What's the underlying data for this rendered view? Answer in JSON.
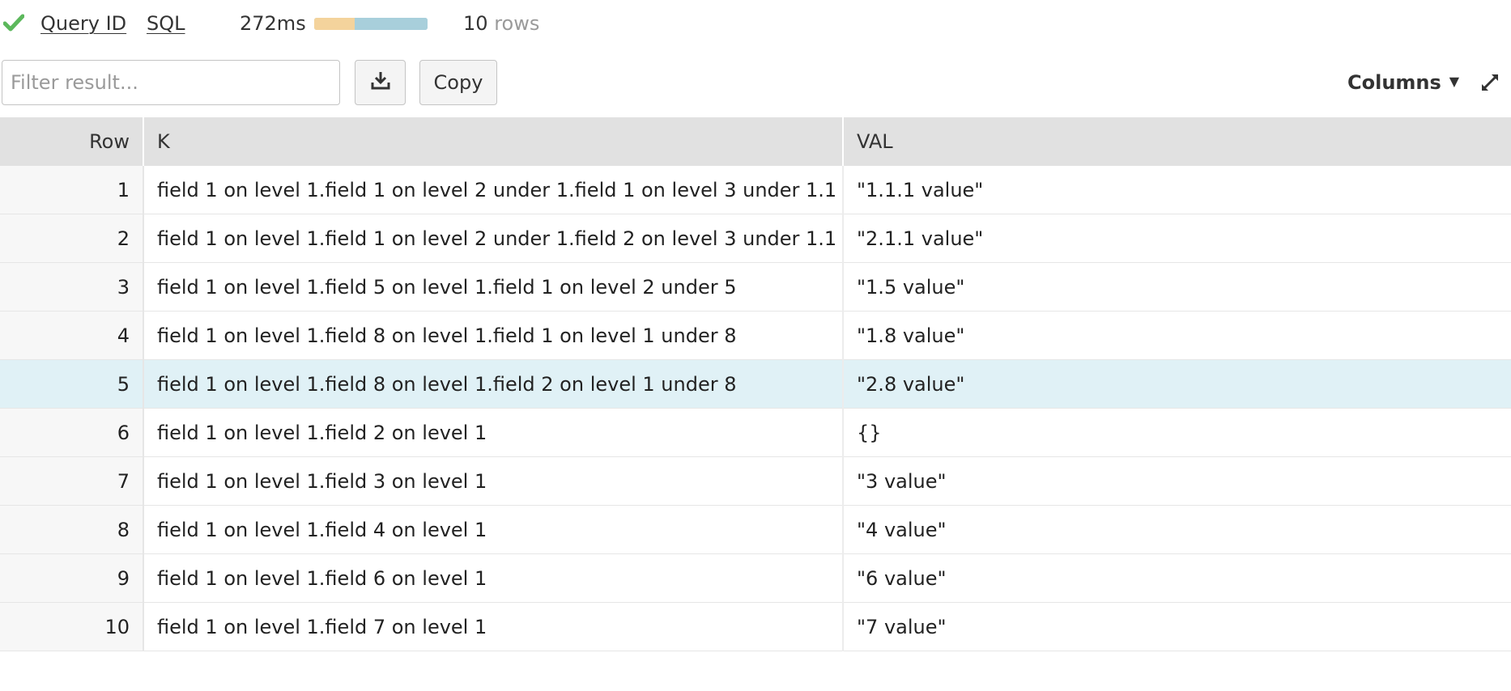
{
  "status": {
    "success_icon": "checkmark-icon",
    "success_color": "#5cb85c",
    "query_id_label": "Query ID",
    "sql_label": "SQL",
    "elapsed": "272ms",
    "timing_colors": [
      "#f4d39c",
      "#a8cfdb"
    ],
    "timing_fraction_first": 0.36,
    "row_count": "10",
    "row_unit": "rows"
  },
  "toolbar": {
    "filter_placeholder": "Filter result...",
    "filter_value": "",
    "download_icon": "download-icon",
    "copy_label": "Copy",
    "columns_label": "Columns",
    "columns_caret": "▼",
    "expand_icon": "expand-icon"
  },
  "table": {
    "columns": [
      "Row",
      "K",
      "VAL"
    ],
    "selected_row": 5,
    "selected_color": "#e0f1f6",
    "rows": [
      {
        "row": "1",
        "k": "field 1 on level 1.field 1 on level 2 under 1.field 1 on level 3 under 1.1",
        "val": "\"1.1.1 value\""
      },
      {
        "row": "2",
        "k": "field 1 on level 1.field 1 on level 2 under 1.field 2 on level 3 under 1.1",
        "val": "\"2.1.1 value\""
      },
      {
        "row": "3",
        "k": "field 1 on level 1.field 5 on level 1.field 1 on level 2 under 5",
        "val": "\"1.5 value\""
      },
      {
        "row": "4",
        "k": "field 1 on level 1.field 8 on level 1.field 1 on level 1 under 8",
        "val": "\"1.8 value\""
      },
      {
        "row": "5",
        "k": "field 1 on level 1.field 8 on level 1.field 2 on level 1 under 8",
        "val": "\"2.8 value\""
      },
      {
        "row": "6",
        "k": "field 1 on level 1.field 2 on level 1",
        "val": "{}"
      },
      {
        "row": "7",
        "k": "field 1 on level 1.field 3 on level 1",
        "val": "\"3 value\""
      },
      {
        "row": "8",
        "k": "field 1 on level 1.field 4 on level 1",
        "val": "\"4 value\""
      },
      {
        "row": "9",
        "k": "field 1 on level 1.field 6 on level 1",
        "val": "\"6 value\""
      },
      {
        "row": "10",
        "k": "field 1 on level 1.field 7 on level 1",
        "val": "\"7 value\""
      }
    ]
  }
}
